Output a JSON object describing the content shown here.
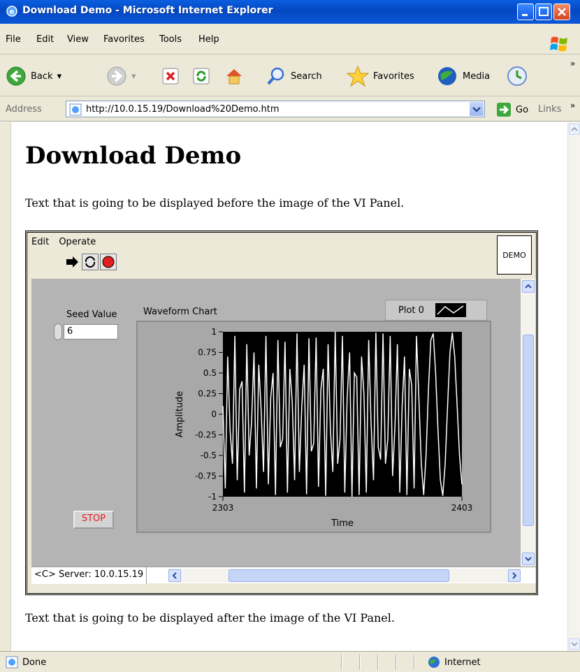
{
  "window": {
    "title": "Download Demo - Microsoft Internet Explorer"
  },
  "menu": {
    "items": [
      "File",
      "Edit",
      "View",
      "Favorites",
      "Tools",
      "Help"
    ]
  },
  "toolbar": {
    "back_label": "Back",
    "search_label": "Search",
    "favorites_label": "Favorites",
    "media_label": "Media"
  },
  "address": {
    "label": "Address",
    "url": "http://10.0.15.19/Download%20Demo.htm",
    "go_label": "Go",
    "links_label": "Links"
  },
  "page": {
    "heading": "Download Demo",
    "text_before": "Text that is going to be displayed before the image of the VI Panel.",
    "text_after": "Text that is going to be displayed after the image of the VI Panel."
  },
  "vi_panel": {
    "menu": [
      "Edit",
      "Operate"
    ],
    "icon_label": "DEMO",
    "seed_label": "Seed Value",
    "seed_value": "6",
    "stop_label": "STOP",
    "chart_label": "Waveform Chart",
    "legend_label": "Plot 0",
    "server_text": "<C> Server: 10.0.15.19"
  },
  "chart_data": {
    "type": "line",
    "title": "Waveform Chart",
    "xlabel": "Time",
    "ylabel": "Amplitude",
    "xlim": [
      2303,
      2403
    ],
    "ylim": [
      -1,
      1
    ],
    "x_ticks": [
      "2303",
      "2403"
    ],
    "y_ticks": [
      "1",
      "0.75",
      "0.5",
      "0.25",
      "0",
      "-0.25",
      "-0.5",
      "-0.75",
      "-1"
    ],
    "grid": false,
    "legend": "top-right",
    "series": [
      {
        "name": "Plot 0",
        "x": [
          2303,
          2304,
          2305,
          2306,
          2307,
          2308,
          2309,
          2310,
          2311,
          2312,
          2313,
          2314,
          2315,
          2316,
          2317,
          2318,
          2319,
          2320,
          2321,
          2322,
          2323,
          2324,
          2325,
          2326,
          2327,
          2328,
          2329,
          2330,
          2331,
          2332,
          2333,
          2334,
          2335,
          2336,
          2337,
          2338,
          2339,
          2340,
          2341,
          2342,
          2343,
          2344,
          2345,
          2346,
          2347,
          2348,
          2349,
          2350,
          2351,
          2352,
          2353,
          2354,
          2355,
          2356,
          2357,
          2358,
          2359,
          2360,
          2361,
          2362,
          2363,
          2364,
          2365,
          2366,
          2367,
          2368,
          2369,
          2370,
          2371,
          2372,
          2373,
          2374,
          2375,
          2376,
          2377,
          2378,
          2379,
          2380,
          2381,
          2382,
          2383,
          2384,
          2385,
          2386,
          2387,
          2388,
          2389,
          2390,
          2391,
          2392,
          2393,
          2394,
          2395,
          2396,
          2397,
          2398,
          2399,
          2400,
          2401,
          2402,
          2403
        ],
        "y": [
          0.1,
          -0.9,
          0.7,
          -0.2,
          -0.6,
          0.95,
          -0.8,
          0.3,
          0.4,
          -0.95,
          0.85,
          -0.5,
          -0.1,
          0.75,
          -0.9,
          0.6,
          0.05,
          -0.7,
          0.95,
          -0.85,
          0.2,
          0.5,
          -0.98,
          0.9,
          -0.4,
          -0.3,
          0.88,
          -0.95,
          0.55,
          0.15,
          -0.8,
          0.98,
          -0.7,
          0.1,
          0.6,
          -0.97,
          0.92,
          -0.45,
          -0.35,
          0.93,
          -0.88,
          0.3,
          0.55,
          -0.99,
          0.85,
          -0.2,
          -0.7,
          1.0,
          -0.6,
          -0.3,
          0.95,
          -0.95,
          0.2,
          0.75,
          -1.0,
          0.5,
          0.45,
          -0.98,
          0.7,
          0.25,
          -0.95,
          0.9,
          -0.1,
          -0.8,
          0.99,
          -0.4,
          -0.55,
          0.98,
          -0.6,
          -0.3,
          0.95,
          -0.75,
          -0.15,
          0.85,
          -0.95,
          0.1,
          0.7,
          -0.98,
          0.55,
          0.35,
          -0.9,
          0.95,
          0.2,
          -0.6,
          -0.98,
          -0.5,
          0.3,
          0.9,
          0.98,
          0.5,
          -0.2,
          -0.8,
          -0.99,
          -0.6,
          0.1,
          0.75,
          0.99,
          0.7,
          0.1,
          -0.5,
          -0.85
        ]
      }
    ]
  },
  "status": {
    "left": "Done",
    "zone": "Internet"
  },
  "colors": {
    "titlebar": "#0a5fe0",
    "chart_bg": "#000000",
    "trace": "#ffffff",
    "panel": "#b4b4b4",
    "stop_text": "#e51b1b"
  }
}
